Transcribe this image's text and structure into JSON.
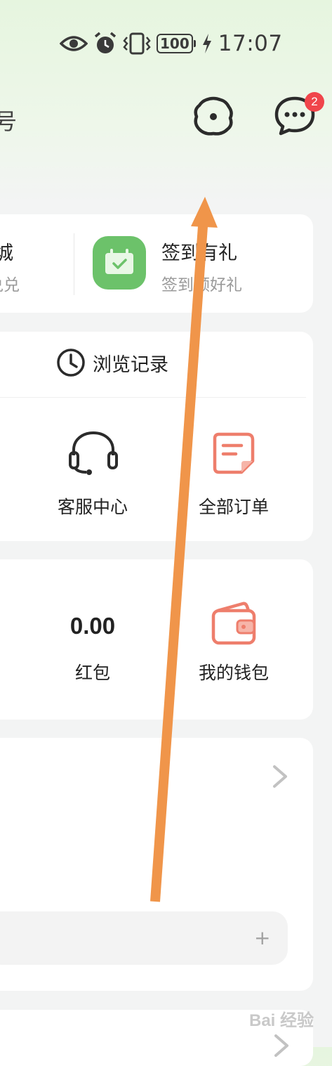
{
  "status_bar": {
    "battery": "100",
    "time": "17:07"
  },
  "header": {
    "left_partial_text": "号",
    "message_badge": "2"
  },
  "top_card": {
    "left_title_partial": "城",
    "left_subtitle_partial": "兑兑",
    "checkin_title": "签到有礼",
    "checkin_subtitle": "签到领好礼"
  },
  "service_card": {
    "history_label": "浏览记录",
    "customer_service_label": "客服中心",
    "all_orders_label": "全部订单"
  },
  "wallet_card": {
    "red_packet_value": "0.00",
    "red_packet_label": "红包",
    "wallet_label": "我的钱包"
  },
  "input_card": {
    "plus": "+"
  },
  "watermark": "Bai 经验",
  "colors": {
    "accent_green": "#6cc26a",
    "order_icon": "#ee7e6c",
    "badge": "#f0454b",
    "annotation_arrow": "#f0954a"
  }
}
